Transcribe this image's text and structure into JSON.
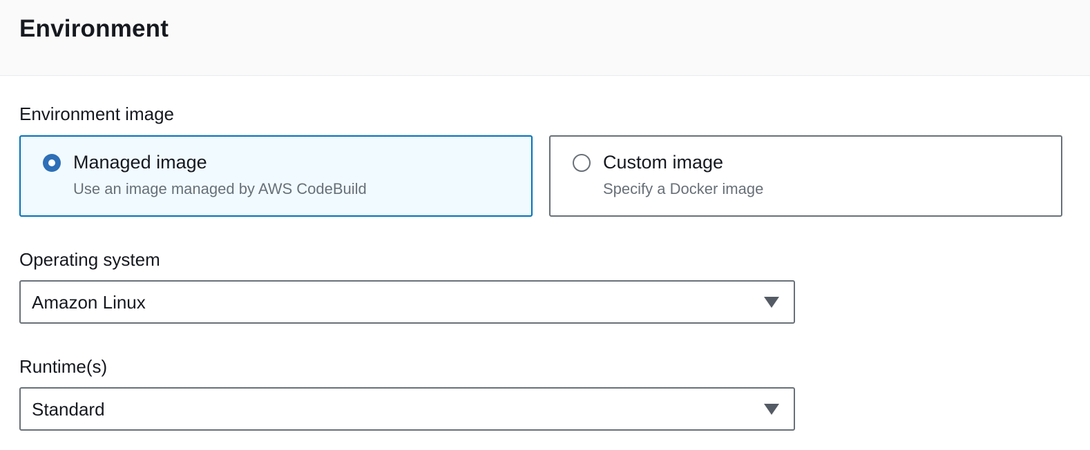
{
  "panel": {
    "title": "Environment"
  },
  "environment_image": {
    "label": "Environment image",
    "options": [
      {
        "title": "Managed image",
        "description": "Use an image managed by AWS CodeBuild",
        "selected": true
      },
      {
        "title": "Custom image",
        "description": "Specify a Docker image",
        "selected": false
      }
    ]
  },
  "operating_system": {
    "label": "Operating system",
    "value": "Amazon Linux"
  },
  "runtimes": {
    "label": "Runtime(s)",
    "value": "Standard"
  },
  "colors": {
    "accent": "#0073bb",
    "radio_checked": "#2e6fb7",
    "selected_tile_bg": "#f1faff",
    "header_bg": "#fafafa",
    "border": "#687078",
    "secondary_text": "#687078"
  },
  "icons": {
    "select_caret": "caret-down-icon",
    "radio_checked": "radio-checked-icon",
    "radio_unchecked": "radio-unchecked-icon"
  }
}
